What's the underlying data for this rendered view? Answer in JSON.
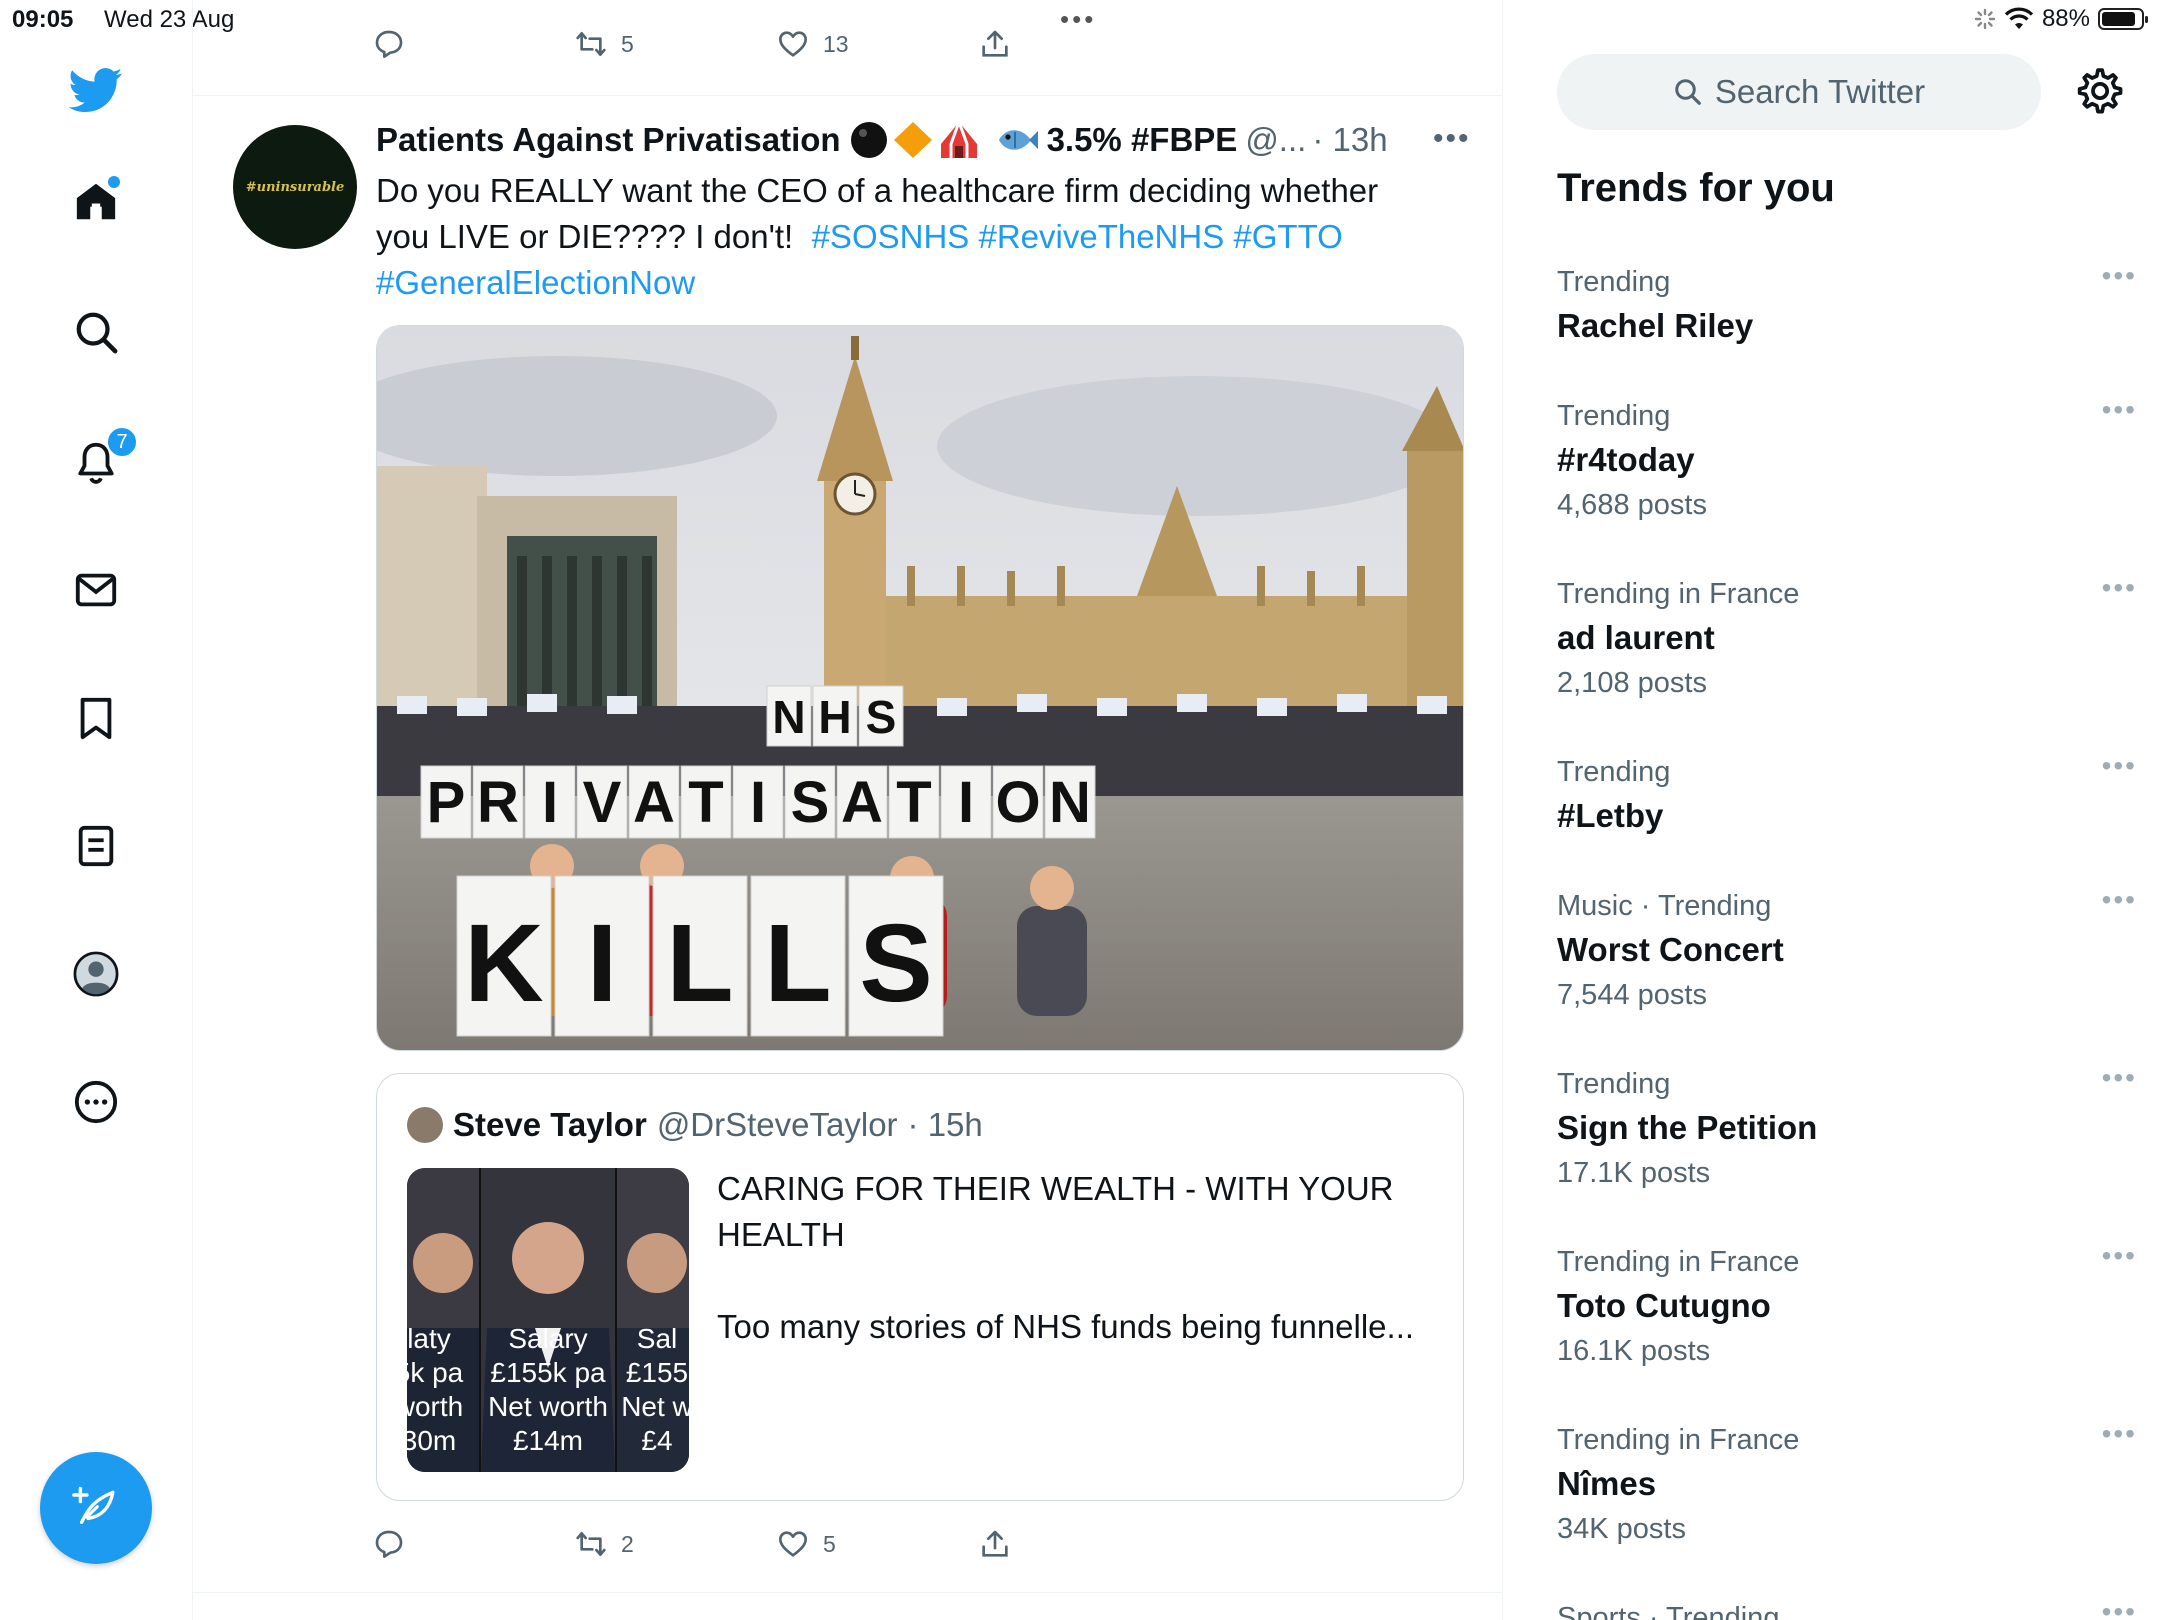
{
  "status_bar": {
    "time": "09:05",
    "date": "Wed 23 Aug",
    "battery": "88%",
    "battery_level": 0.88
  },
  "nav": {
    "notifications_badge": "7",
    "items": [
      "twitter-logo",
      "home-icon",
      "search-icon",
      "bell-icon",
      "mail-icon",
      "bookmark-icon",
      "lists-icon",
      "profile-icon",
      "more-icon"
    ],
    "compose_icon": "feather-plus-icon",
    "accent": "#1d9bf0"
  },
  "prev_tweet": {
    "retweets": "5",
    "likes": "13"
  },
  "tweet": {
    "display_name": "Patients Against Privatisation",
    "name_suffix": "3.5% #FBPE",
    "handle": "@...",
    "time": "· 13h",
    "avatar_text": "#uninsurable",
    "text_plain": "Do you REALLY want the CEO of a healthcare firm deciding whether you LIVE or DIE???? I don't!",
    "tags": [
      "#SOSNHS",
      "#ReviveTheNHS",
      "#GTTO",
      "#GeneralElectionNow"
    ],
    "photo": {
      "signs": [
        "N",
        "H",
        "S"
      ],
      "row2": [
        "P",
        "R",
        "I",
        "V",
        "A",
        "T",
        "I",
        "S",
        "A",
        "T",
        "I",
        "O",
        "N"
      ],
      "row3": [
        "K",
        "I",
        "L",
        "L",
        "S"
      ]
    },
    "quote": {
      "name": "Steve Taylor",
      "handle": "@DrSteveTaylor",
      "time": "· 15h",
      "line1": "CARING FOR THEIR WEALTH - WITH YOUR HEALTH",
      "line2": "Too many stories of NHS funds being funnelle...",
      "panels": [
        {
          "l1": "laty",
          "l2": "5k pa",
          "l3": "worth",
          "l4": "30m"
        },
        {
          "l1": "Salary",
          "l2": "£155k pa",
          "l3": "Net worth",
          "l4": "£14m"
        },
        {
          "l1": "Sal",
          "l2": "£155",
          "l3": "Net w",
          "l4": "£4"
        }
      ]
    },
    "retweets": "2",
    "likes": "5"
  },
  "sidebar": {
    "search_placeholder": "Search Twitter",
    "trends_title": "Trends for you",
    "trends": [
      {
        "context": "Trending",
        "topic": "Rachel Riley",
        "count": ""
      },
      {
        "context": "Trending",
        "topic": "#r4today",
        "count": "4,688 posts"
      },
      {
        "context": "Trending in France",
        "topic": "ad laurent",
        "count": "2,108 posts"
      },
      {
        "context": "Trending",
        "topic": "#Letby",
        "count": ""
      },
      {
        "context": "Music · Trending",
        "topic": "Worst Concert",
        "count": "7,544 posts"
      },
      {
        "context": "Trending",
        "topic": "Sign the Petition",
        "count": "17.1K posts"
      },
      {
        "context": "Trending in France",
        "topic": "Toto Cutugno",
        "count": "16.1K posts"
      },
      {
        "context": "Trending in France",
        "topic": "Nîmes",
        "count": "34K posts"
      },
      {
        "context": "Sports · Trending",
        "topic": "",
        "count": ""
      }
    ]
  }
}
